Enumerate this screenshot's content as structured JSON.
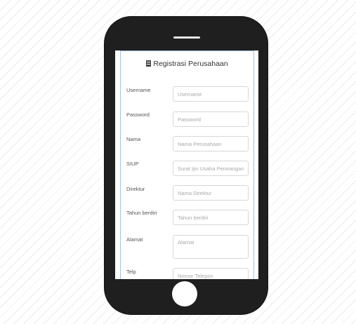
{
  "form": {
    "title": "Registrasi Perusahaan",
    "icon": "building-icon",
    "fields": [
      {
        "label": "Username",
        "placeholder": "Username"
      },
      {
        "label": "Password",
        "placeholder": "Password"
      },
      {
        "label": "Nama",
        "placeholder": "Nama Perusahaan"
      },
      {
        "label": "SIUP",
        "placeholder": "Surat Ijin Usaha Perorangan"
      },
      {
        "label": "Direktur",
        "placeholder": "Nama Direktur"
      },
      {
        "label": "Tahun berdiri",
        "placeholder": "Tahun berdiri"
      },
      {
        "label": "Alamat",
        "placeholder": "Alamat"
      },
      {
        "label": "Telp",
        "placeholder": "Nomor Telepon"
      }
    ]
  },
  "colors": {
    "phone_body": "#1f1f1f",
    "form_border": "#9ec1e6"
  }
}
